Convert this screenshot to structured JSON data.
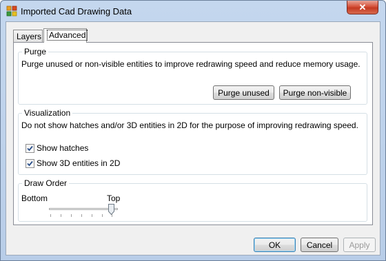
{
  "window": {
    "title": "Imported Cad Drawing Data",
    "close_label": "✕"
  },
  "tabs": [
    {
      "label": "Layers",
      "active": false
    },
    {
      "label": "Advanced",
      "active": true
    }
  ],
  "purge": {
    "title": "Purge",
    "description": "Purge unused or non-visible entities to improve redrawing speed and reduce memory usage.",
    "purge_unused_label": "Purge unused",
    "purge_nonvisible_label": "Purge non-visible"
  },
  "visualization": {
    "title": "Visualization",
    "description": "Do not show hatches and/or 3D entities in 2D for the purpose of improving redrawing speed.",
    "show_hatches": {
      "label": "Show hatches",
      "checked": true
    },
    "show_3d": {
      "label": "Show 3D entities in 2D",
      "checked": true
    }
  },
  "draw_order": {
    "title": "Draw Order",
    "bottom_label": "Bottom",
    "top_label": "Top",
    "value": 1
  },
  "buttons": {
    "ok": "OK",
    "cancel": "Cancel",
    "apply": "Apply"
  }
}
